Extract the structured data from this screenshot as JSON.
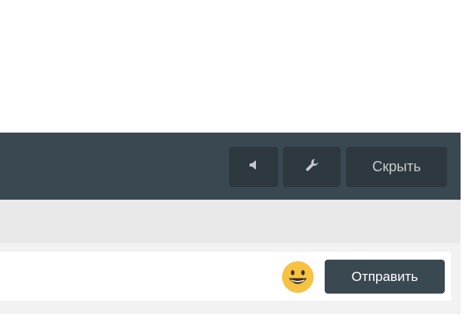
{
  "header": {
    "mute_icon": "speaker-icon",
    "settings_icon": "wrench-icon",
    "hide_label": "Скрыть"
  },
  "composer": {
    "emoji_icon": "smiley-icon",
    "send_label": "Отправить"
  },
  "colors": {
    "header_bg": "#3a4851",
    "header_button_bg": "#2e393f",
    "messages_bg": "#e9e9e9",
    "send_button_bg": "#3a4851",
    "emoji_yellow": "#f6c243"
  }
}
